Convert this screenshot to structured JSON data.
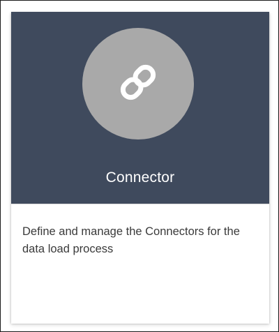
{
  "card": {
    "title": "Connector",
    "description": "Define and manage the Connectors for the data load process",
    "icon": "link-icon"
  },
  "colors": {
    "header_bg": "#3f4a5d",
    "icon_circle_bg": "#a9a9a9",
    "title_text": "#ffffff",
    "body_text": "#3a3a3a"
  }
}
